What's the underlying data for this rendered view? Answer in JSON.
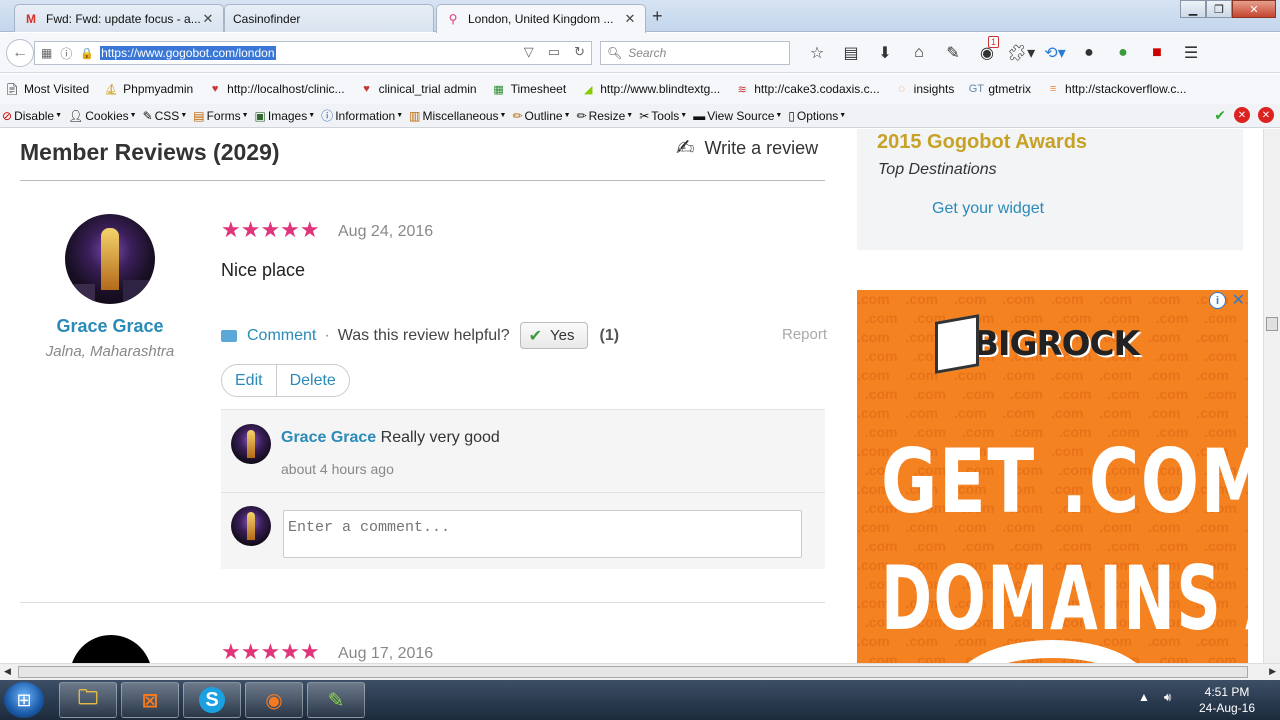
{
  "browser": {
    "tabs": [
      {
        "title": "Fwd: Fwd: update focus - a...",
        "icon": "gmail-icon"
      },
      {
        "title": "Casinofinder",
        "icon": ""
      },
      {
        "title": "London, United Kingdom ...",
        "icon": "location-pin-icon"
      }
    ],
    "url": "https://www.gogobot.com/london",
    "search_placeholder": "Search",
    "notification_badge": "1",
    "bookmarks": [
      "Most Visited",
      "Phpmyadmin",
      "http://localhost/clinic...",
      "clinical_trial admin",
      "Timesheet",
      "http://www.blindtextg...",
      "http://cake3.codaxis.c...",
      "insights",
      "gtmetrix",
      "http://stackoverflow.c..."
    ],
    "devtools": [
      "Disable",
      "Cookies",
      "CSS",
      "Forms",
      "Images",
      "Information",
      "Miscellaneous",
      "Outline",
      "Resize",
      "Tools",
      "View Source",
      "Options"
    ]
  },
  "reviews": {
    "title": "Member Reviews (2029)",
    "write_label": "Write a review",
    "first": {
      "reviewer_name": "Grace Grace",
      "reviewer_location": "Jalna, Maharashtra",
      "stars": "★★★★★",
      "rating": 5,
      "date": "Aug 24, 2016",
      "text": "Nice place",
      "comment_label": "Comment",
      "helpful_question": "Was this review helpful?",
      "yes_label": "Yes",
      "helpful_count": "(1)",
      "report_label": "Report",
      "edit_label": "Edit",
      "delete_label": "Delete",
      "comments": [
        {
          "author": "Grace Grace",
          "text": "Really very good",
          "time": "about 4 hours ago"
        }
      ],
      "comment_placeholder": "Enter a comment..."
    },
    "second": {
      "stars": "★★★★★",
      "rating": 5,
      "date": "Aug 17, 2016"
    }
  },
  "sidebar": {
    "awards_title": "2015 Gogobot Awards",
    "awards_subtitle": "Top Destinations",
    "widget_link": "Get your widget"
  },
  "ad": {
    "brand": "BIGROCK",
    "line1": "GET .COM",
    "line2": "DOMAINS AT",
    "pattern_text": ".com"
  },
  "taskbar": {
    "time": "4:51 PM",
    "date": "24-Aug-16"
  },
  "colors": {
    "link_blue": "#2a8ab8",
    "star_pink": "#e0357a",
    "award_gold": "#c7a227",
    "ad_orange": "#f58220"
  }
}
